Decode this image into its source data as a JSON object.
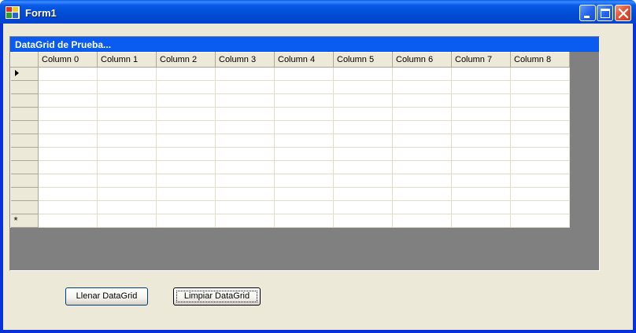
{
  "window": {
    "title": "Form1",
    "controls": {
      "minimize": "minimize",
      "maximize": "maximize",
      "close": "close"
    }
  },
  "datagrid": {
    "caption": "DataGrid de Prueba...",
    "columns": [
      "Column 0",
      "Column 1",
      "Column 2",
      "Column 3",
      "Column 4",
      "Column 5",
      "Column 6",
      "Column 7",
      "Column 8"
    ],
    "rows": [
      {
        "indicator": "current-row-arrow",
        "cells": [
          "",
          "",
          "",
          "",
          "",
          "",
          "",
          "",
          ""
        ]
      },
      {
        "indicator": "",
        "cells": [
          "",
          "",
          "",
          "",
          "",
          "",
          "",
          "",
          ""
        ]
      },
      {
        "indicator": "",
        "cells": [
          "",
          "",
          "",
          "",
          "",
          "",
          "",
          "",
          ""
        ]
      },
      {
        "indicator": "",
        "cells": [
          "",
          "",
          "",
          "",
          "",
          "",
          "",
          "",
          ""
        ]
      },
      {
        "indicator": "",
        "cells": [
          "",
          "",
          "",
          "",
          "",
          "",
          "",
          "",
          ""
        ]
      },
      {
        "indicator": "",
        "cells": [
          "",
          "",
          "",
          "",
          "",
          "",
          "",
          "",
          ""
        ]
      },
      {
        "indicator": "",
        "cells": [
          "",
          "",
          "",
          "",
          "",
          "",
          "",
          "",
          ""
        ]
      },
      {
        "indicator": "",
        "cells": [
          "",
          "",
          "",
          "",
          "",
          "",
          "",
          "",
          ""
        ]
      },
      {
        "indicator": "",
        "cells": [
          "",
          "",
          "",
          "",
          "",
          "",
          "",
          "",
          ""
        ]
      },
      {
        "indicator": "",
        "cells": [
          "",
          "",
          "",
          "",
          "",
          "",
          "",
          "",
          ""
        ]
      },
      {
        "indicator": "",
        "cells": [
          "",
          "",
          "",
          "",
          "",
          "",
          "",
          "",
          ""
        ]
      },
      {
        "indicator": "new-row-asterisk",
        "cells": [
          "",
          "",
          "",
          "",
          "",
          "",
          "",
          "",
          ""
        ]
      }
    ],
    "new_row_symbol": "*"
  },
  "buttons": {
    "fill_label": "Llenar DataGrid",
    "clear_label": "Limpiar DataGrid"
  },
  "colors": {
    "titlebar": "#0054e3",
    "caption": "#0a5cf0",
    "form_background": "#ece9d8",
    "grid_background": "#808080"
  }
}
